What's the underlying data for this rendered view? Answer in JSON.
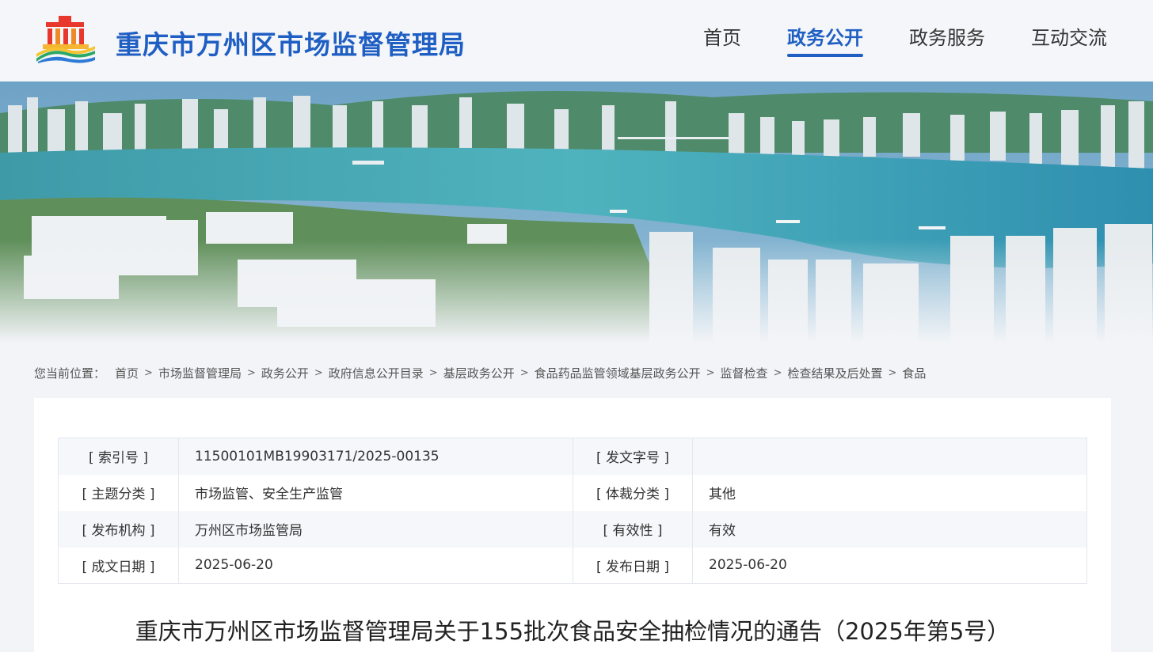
{
  "header": {
    "site_title": "重庆市万州区市场监督管理局",
    "logo_icon": "government-emblem-logo",
    "nav": [
      {
        "label": "首页",
        "active": false
      },
      {
        "label": "政务公开",
        "active": true
      },
      {
        "label": "政务服务",
        "active": false
      },
      {
        "label": "互动交流",
        "active": false
      }
    ]
  },
  "breadcrumb": {
    "prefix": "您当前位置：",
    "items": [
      "首页",
      "市场监督管理局",
      "政务公开",
      "政府信息公开目录",
      "基层政务公开",
      "食品药品监管领域基层政务公开",
      "监督检查",
      "检查结果及后处置",
      "食品"
    ],
    "separator": ">"
  },
  "meta": {
    "index_no_label": "[ 索引号 ]",
    "index_no_value": "11500101MB19903171/2025-00135",
    "doc_no_label": "[ 发文字号 ]",
    "doc_no_value": "",
    "topic_label": "[ 主题分类 ]",
    "topic_value": "市场监管、安全生产监管",
    "genre_label": "[ 体裁分类 ]",
    "genre_value": "其他",
    "issuer_label": "[ 发布机构 ]",
    "issuer_value": "万州区市场监管局",
    "validity_label": "[ 有效性 ]",
    "validity_value": "有效",
    "written_date_label": "[ 成文日期 ]",
    "written_date_value": "2025-06-20",
    "publish_date_label": "[ 发布日期 ]",
    "publish_date_value": "2025-06-20"
  },
  "document": {
    "title": "重庆市万州区市场监督管理局关于155批次食品安全抽检情况的通告（2025年第5号）"
  },
  "colors": {
    "brand_blue": "#1f5fc4",
    "page_bg": "#f2f4f7",
    "row_alt": "#f5f7fa"
  }
}
